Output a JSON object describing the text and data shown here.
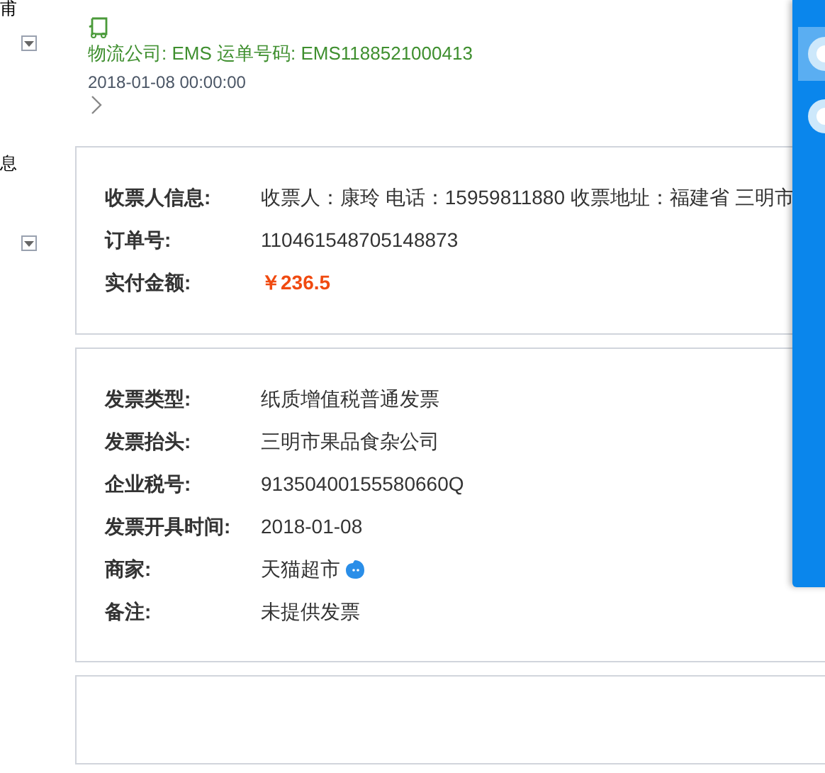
{
  "side_labels": [
    "甫",
    "息"
  ],
  "logistics": {
    "company_line": "物流公司: EMS 运单号码: EMS1188521000413",
    "time": "2018-01-08 00:00:00"
  },
  "receiver_card": {
    "rows": [
      {
        "label": "收票人信息:",
        "value": "收票人：康玲 电话：15959811880 收票地址：福建省 三明市",
        "kind": "text"
      },
      {
        "label": "订单号:",
        "value": "110461548705148873",
        "kind": "text"
      },
      {
        "label": "实付金额:",
        "value": "￥236.5",
        "kind": "price"
      }
    ]
  },
  "invoice_card": {
    "rows": [
      {
        "label": "发票类型:",
        "value": "纸质增值税普通发票",
        "kind": "text"
      },
      {
        "label": "发票抬头:",
        "value": "三明市果品食杂公司",
        "kind": "text"
      },
      {
        "label": "企业税号:",
        "value": "91350400155580660Q",
        "kind": "text"
      },
      {
        "label": "发票开具时间:",
        "value": "2018-01-08",
        "kind": "text"
      },
      {
        "label": "商家:",
        "value": "天猫超市",
        "kind": "shop"
      },
      {
        "label": "备注:",
        "value": "未提供发票",
        "kind": "text"
      }
    ]
  },
  "side_panel": {
    "buttons": [
      {
        "selected": true
      },
      {
        "selected": false
      }
    ]
  }
}
